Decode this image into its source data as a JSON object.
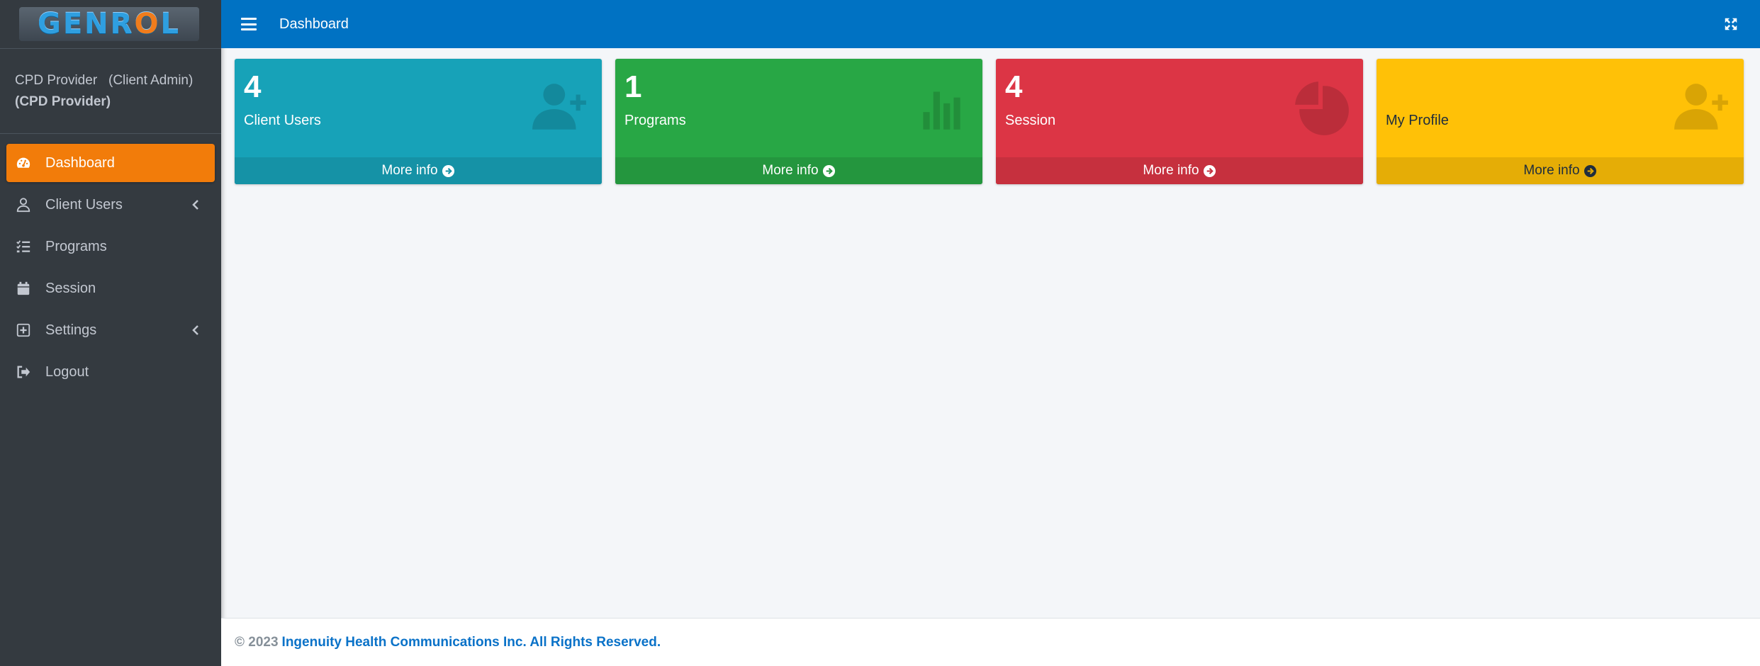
{
  "brand": {
    "logo_text_left": "GENR",
    "logo_text_o": "O",
    "logo_text_right": "L"
  },
  "user": {
    "name": "CPD Provider",
    "role": "(Client Admin)",
    "org": "(CPD Provider)"
  },
  "sidebar": {
    "items": [
      {
        "label": "Dashboard",
        "icon": "dashboard-gauge-icon",
        "active": true
      },
      {
        "label": "Client Users",
        "icon": "user-icon",
        "has_submenu": true
      },
      {
        "label": "Programs",
        "icon": "tasks-list-icon"
      },
      {
        "label": "Session",
        "icon": "calendar-icon"
      },
      {
        "label": "Settings",
        "icon": "plus-square-icon",
        "has_submenu": true
      },
      {
        "label": "Logout",
        "icon": "sign-out-icon"
      }
    ]
  },
  "navbar": {
    "title": "Dashboard"
  },
  "boxes": [
    {
      "count": "4",
      "label": "Client Users",
      "link": "More info",
      "color": "#17a2b8",
      "icon": "user-plus-icon"
    },
    {
      "count": "1",
      "label": "Programs",
      "link": "More info",
      "color": "#28a745",
      "icon": "bar-chart-icon"
    },
    {
      "count": "4",
      "label": "Session",
      "link": "More info",
      "color": "#dc3545",
      "icon": "pie-chart-icon"
    },
    {
      "count": "",
      "label": "My Profile",
      "link": "More info",
      "color": "#ffc107",
      "icon": "user-plus-icon"
    }
  ],
  "footer": {
    "copyright": "© 2023",
    "company": "Ingenuity Health Communications Inc. All Rights Reserved."
  },
  "colors": {
    "navbar": "#0072c3",
    "sidebar": "#343a40",
    "active_item": "#f27c0a"
  }
}
